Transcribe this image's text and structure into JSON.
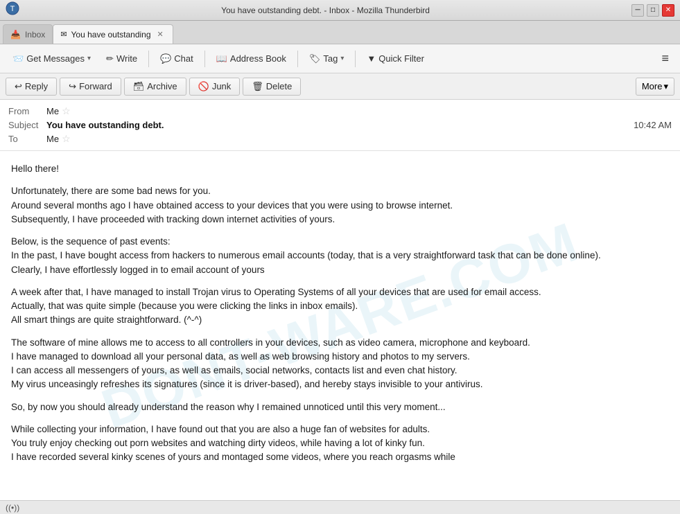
{
  "window": {
    "title": "You have outstanding debt. - Inbox - Mozilla Thunderbird",
    "app_icon": "🦅"
  },
  "tabs": [
    {
      "id": "inbox",
      "icon": "📥",
      "label": "Inbox",
      "active": false,
      "closeable": false
    },
    {
      "id": "email",
      "icon": "✉",
      "label": "You have outstanding",
      "active": true,
      "closeable": true
    }
  ],
  "toolbar": {
    "get_messages_label": "Get Messages",
    "get_messages_dropdown": "▾",
    "write_label": "Write",
    "chat_label": "Chat",
    "address_book_label": "Address Book",
    "tag_label": "Tag",
    "tag_dropdown": "▾",
    "quick_filter_label": "Quick Filter",
    "menu_icon": "≡"
  },
  "action_bar": {
    "reply_label": "Reply",
    "reply_icon": "↩",
    "forward_label": "Forward",
    "forward_icon": "↪",
    "archive_label": "Archive",
    "archive_icon": "🗃",
    "junk_label": "Junk",
    "junk_icon": "🚫",
    "delete_label": "Delete",
    "delete_icon": "🗑",
    "more_label": "More",
    "more_dropdown": "▾"
  },
  "email": {
    "from_label": "From",
    "from_value": "Me",
    "subject_label": "Subject",
    "subject_value": "You have outstanding debt.",
    "to_label": "To",
    "to_value": "Me",
    "time": "10:42 AM",
    "body_paragraphs": [
      "Hello there!",
      "Unfortunately, there are some bad news for you.\nAround several months ago I have obtained access to your devices that you were using to browse internet.\nSubsequently, I have proceeded with tracking down internet activities of yours.",
      "Below, is the sequence of past events:\nIn the past, I have bought access from hackers to numerous email accounts (today, that is a very straightforward task that can be done online).\nClearly, I have effortlessly logged in to email account of yours",
      "A week after that, I have managed to install Trojan virus to Operating Systems of all your devices that are used for email access.\nActually, that was quite simple (because you were clicking the links in inbox emails).\nAll smart things are quite straightforward. (^-^)",
      "The software of mine allows me to access to all controllers in your devices, such as video camera, microphone and keyboard.\nI have managed to download all your personal data, as well as web browsing history and photos to my servers.\nI can access all messengers of yours, as well as emails, social networks, contacts list and even chat history.\nMy virus unceasingly refreshes its signatures (since it is driver-based), and hereby stays invisible to your antivirus.",
      "So, by now you should already understand the reason why I remained unnoticed until this very moment...",
      "While collecting your information, I have found out that you are also a huge fan of websites for adults.\nYou truly enjoy checking out porn websites and watching dirty videos, while having a lot of kinky fun.\nI have recorded several kinky scenes of yours and montaged some videos, where you reach orgasms while"
    ]
  },
  "watermark": {
    "text": "DONT-WARE.COM"
  },
  "status_bar": {
    "wifi_icon": "((•))"
  }
}
